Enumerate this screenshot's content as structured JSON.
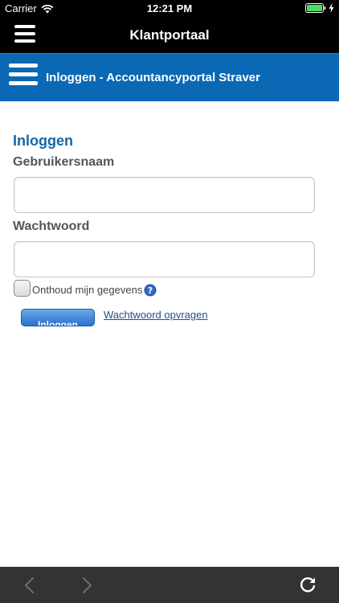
{
  "status_bar": {
    "carrier": "Carrier",
    "time": "12:21 PM",
    "icons": [
      "wifi-icon",
      "battery-icon",
      "charging-icon"
    ]
  },
  "nav_bar": {
    "title": "Klantportaal",
    "menu_icon": "hamburger-menu-icon"
  },
  "web_header": {
    "title": "Inloggen - Accountancyportal Straver",
    "menu_icon": "hamburger-menu-icon"
  },
  "login_form": {
    "heading": "Inloggen",
    "username_label": "Gebruikersnaam",
    "username_value": "",
    "password_label": "Wachtwoord",
    "password_value": "",
    "remember_label": "Onthoud mijn gegevens",
    "remember_checked": false,
    "help_icon": "question-mark-icon",
    "login_button": "Inloggen",
    "forgot_link": "Wachtwoord opvragen"
  },
  "toolbar": {
    "icons": [
      "chevron-left-icon",
      "chevron-right-icon",
      "reload-icon"
    ]
  },
  "colors": {
    "header_blue": "#0a68b5",
    "heading_blue": "#1366a6",
    "toolbar": "#333333"
  }
}
